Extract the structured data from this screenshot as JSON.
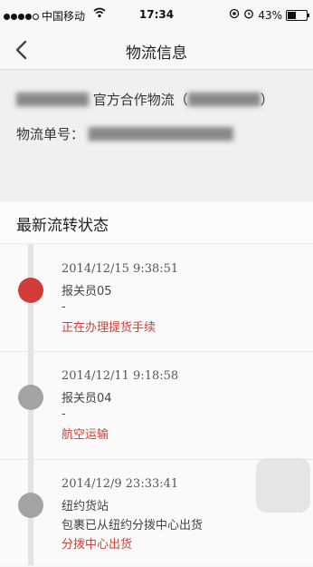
{
  "status_bar": {
    "carrier": "中国移动",
    "time": "17:34",
    "battery": "43%",
    "battery_level": 0.43
  },
  "nav": {
    "title": "物流信息",
    "back_icon": "chevron-left-icon"
  },
  "info": {
    "partner_prefix": "",
    "partner_label": "官方合作物流（",
    "partner_suffix": "）",
    "tracking_label": "物流单号：",
    "tracking_value": ""
  },
  "section": {
    "title": "最新流转状态"
  },
  "timeline": [
    {
      "time": "2014/12/15 9:38:51",
      "place": "报关员05",
      "desc": "-",
      "status": "正在办理提货手续",
      "active": true
    },
    {
      "time": "2014/12/11 9:18:58",
      "place": "报关员04",
      "desc": "-",
      "status": "航空运输",
      "active": false
    },
    {
      "time": "2014/12/9 23:33:41",
      "place": "纽约货站",
      "desc": "包裹已从纽约分拨中心出货",
      "status": "分拨中心出货",
      "active": false
    }
  ],
  "colors": {
    "accent": "#d33a3a",
    "status_text": "#c8443a",
    "inactive_dot": "#a3a3a3"
  }
}
